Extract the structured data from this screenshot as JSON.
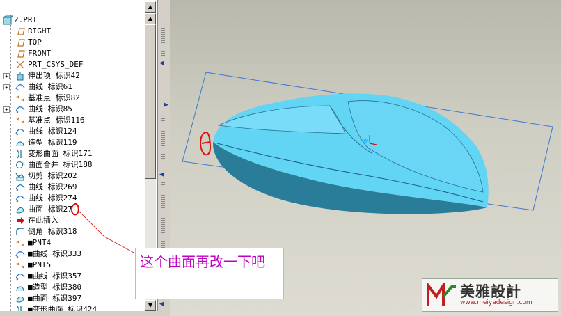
{
  "tree": {
    "root": "2.PRT",
    "items": [
      {
        "label": "RIGHT",
        "icon": "datum-plane-icon"
      },
      {
        "label": "TOP",
        "icon": "datum-plane-icon"
      },
      {
        "label": "FRONT",
        "icon": "datum-plane-icon"
      },
      {
        "label": "PRT_CSYS_DEF",
        "icon": "csys-icon"
      },
      {
        "label": "伸出项 标识42",
        "icon": "extrude-icon",
        "expandable": true
      },
      {
        "label": "曲线 标识61",
        "icon": "curve-icon",
        "expandable": true
      },
      {
        "label": "基准点 标识82",
        "icon": "datum-point-icon"
      },
      {
        "label": "曲线 标识85",
        "icon": "curve-icon",
        "expandable": true
      },
      {
        "label": "基准点 标识116",
        "icon": "datum-point-icon"
      },
      {
        "label": "曲线 标识124",
        "icon": "curve-icon"
      },
      {
        "label": "造型 标识119",
        "icon": "style-icon"
      },
      {
        "label": "变形曲面 标识171",
        "icon": "warp-surface-icon"
      },
      {
        "label": "曲面合并 标识188",
        "icon": "merge-icon"
      },
      {
        "label": "切剪 标识202",
        "icon": "cut-icon"
      },
      {
        "label": "曲线 标识269",
        "icon": "curve-icon"
      },
      {
        "label": "曲线 标识274",
        "icon": "curve-icon"
      },
      {
        "label": "曲面 标识27",
        "icon": "surface-icon"
      },
      {
        "label": "在此插入",
        "icon": "insert-here-arrow-icon"
      },
      {
        "label": "倒角 标识318",
        "icon": "round-icon"
      },
      {
        "label": "■PNT4",
        "icon": "datum-point-icon"
      },
      {
        "label": "■曲线 标识333",
        "icon": "curve-icon"
      },
      {
        "label": "■PNT5",
        "icon": "datum-point-icon"
      },
      {
        "label": "■曲线 标识357",
        "icon": "curve-icon"
      },
      {
        "label": "■造型 标识380",
        "icon": "style-icon"
      },
      {
        "label": "■曲面 标识397",
        "icon": "surface-icon"
      },
      {
        "label": "■变形曲面 标识424",
        "icon": "warp-surface-icon"
      }
    ]
  },
  "annotation": {
    "callout_text": "这个曲面再改一下吧",
    "color": "#c000c0"
  },
  "watermark": {
    "brand": "美雅設計",
    "url": "www.meiyadesign.com"
  },
  "colors": {
    "model_top": "#62d4f4",
    "model_side": "#2a7d98",
    "bounding_box": "#3b78d0",
    "handwritten_mark": "#e01010"
  }
}
